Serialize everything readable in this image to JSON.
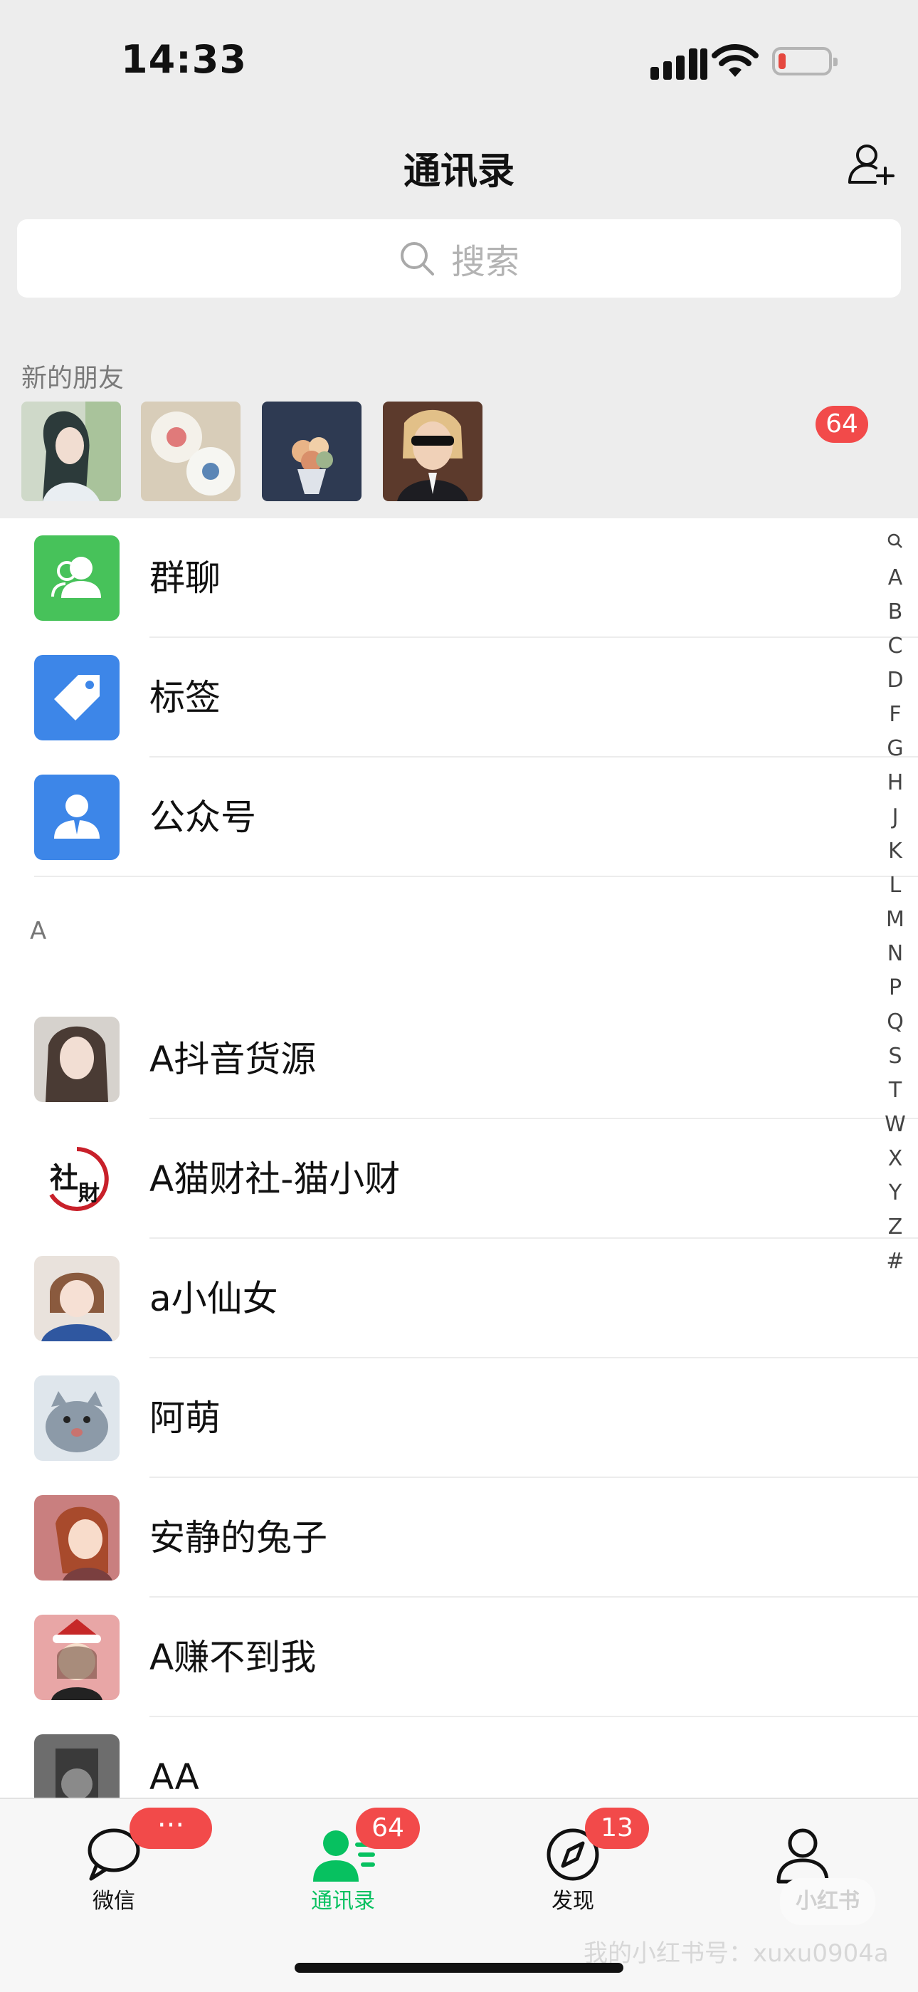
{
  "status_bar": {
    "time": "14:33"
  },
  "header": {
    "title": "通讯录"
  },
  "search": {
    "placeholder": "搜索"
  },
  "new_friends": {
    "label": "新的朋友",
    "badge": "64"
  },
  "functions": [
    {
      "label": "群聊",
      "icon": "group-chat-icon",
      "color": "#47c25a"
    },
    {
      "label": "标签",
      "icon": "tag-icon",
      "color": "#3d86e8"
    },
    {
      "label": "公众号",
      "icon": "official-account-icon",
      "color": "#3d86e8"
    }
  ],
  "section": {
    "letter": "A"
  },
  "contacts": [
    {
      "name": "A抖音货源"
    },
    {
      "name": "A猫财社-猫小财"
    },
    {
      "name": "a小仙女"
    },
    {
      "name": "阿萌"
    },
    {
      "name": "安静的兔子"
    },
    {
      "name": "A赚不到我"
    },
    {
      "name": "AA"
    }
  ],
  "index_letters": [
    "A",
    "B",
    "C",
    "D",
    "F",
    "G",
    "H",
    "J",
    "K",
    "L",
    "M",
    "N",
    "P",
    "Q",
    "S",
    "T",
    "W",
    "X",
    "Y",
    "Z",
    "#"
  ],
  "tabs": [
    {
      "label": "微信",
      "badge": "···",
      "icon": "chat-bubble-icon"
    },
    {
      "label": "通讯录",
      "badge": "64",
      "icon": "contacts-icon",
      "active": true
    },
    {
      "label": "发现",
      "badge": "13",
      "icon": "compass-icon"
    },
    {
      "label": "我",
      "icon": "person-icon"
    }
  ],
  "watermark": {
    "text": "我的小红书号：xuxu0904a",
    "logo": "小红书"
  }
}
